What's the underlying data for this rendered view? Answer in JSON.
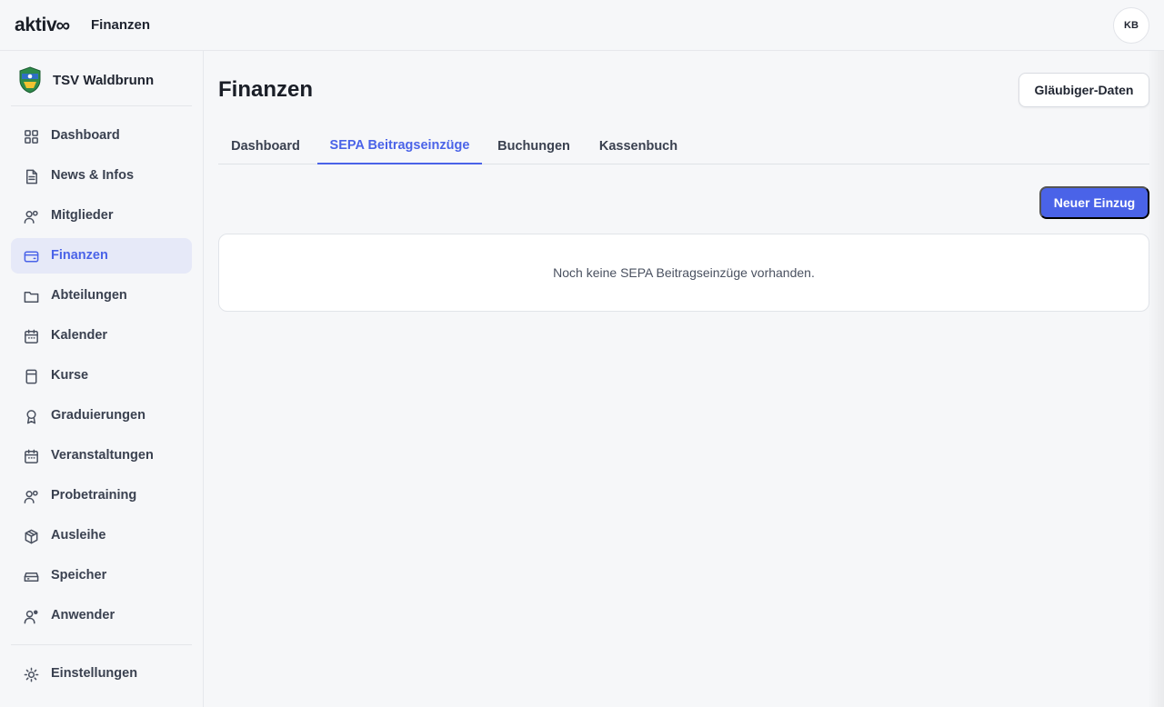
{
  "topbar": {
    "brand": "aktiv",
    "brand_mark": "∞",
    "section_title": "Finanzen",
    "avatar_initials": "KB"
  },
  "sidebar": {
    "club_name": "TSV Waldbrunn",
    "items": [
      {
        "label": "Dashboard",
        "icon": "grid-icon",
        "active": false
      },
      {
        "label": "News & Infos",
        "icon": "document-icon",
        "active": false
      },
      {
        "label": "Mitglieder",
        "icon": "users-icon",
        "active": false
      },
      {
        "label": "Finanzen",
        "icon": "wallet-icon",
        "active": true
      },
      {
        "label": "Abteilungen",
        "icon": "folder-icon",
        "active": false
      },
      {
        "label": "Kalender",
        "icon": "calendar-icon",
        "active": false
      },
      {
        "label": "Kurse",
        "icon": "book-icon",
        "active": false
      },
      {
        "label": "Graduierungen",
        "icon": "award-icon",
        "active": false
      },
      {
        "label": "Veranstaltungen",
        "icon": "calendar-icon",
        "active": false
      },
      {
        "label": "Probetraining",
        "icon": "users-icon",
        "active": false
      },
      {
        "label": "Ausleihe",
        "icon": "package-icon",
        "active": false
      },
      {
        "label": "Speicher",
        "icon": "storage-icon",
        "active": false
      },
      {
        "label": "Anwender",
        "icon": "user-cog-icon",
        "active": false
      }
    ],
    "settings_label": "Einstellungen"
  },
  "main": {
    "title": "Finanzen",
    "creditor_button": "Gläubiger-Daten",
    "tabs": [
      {
        "label": "Dashboard",
        "active": false
      },
      {
        "label": "SEPA Beitragseinzüge",
        "active": true
      },
      {
        "label": "Buchungen",
        "active": false
      },
      {
        "label": "Kassenbuch",
        "active": false
      }
    ],
    "new_button": "Neuer Einzug",
    "empty_message": "Noch keine SEPA Beitragseinzüge vorhanden."
  },
  "colors": {
    "accent": "#4a63e8",
    "active_bg": "#e6e9f8",
    "page_bg": "#f6f7f9"
  }
}
